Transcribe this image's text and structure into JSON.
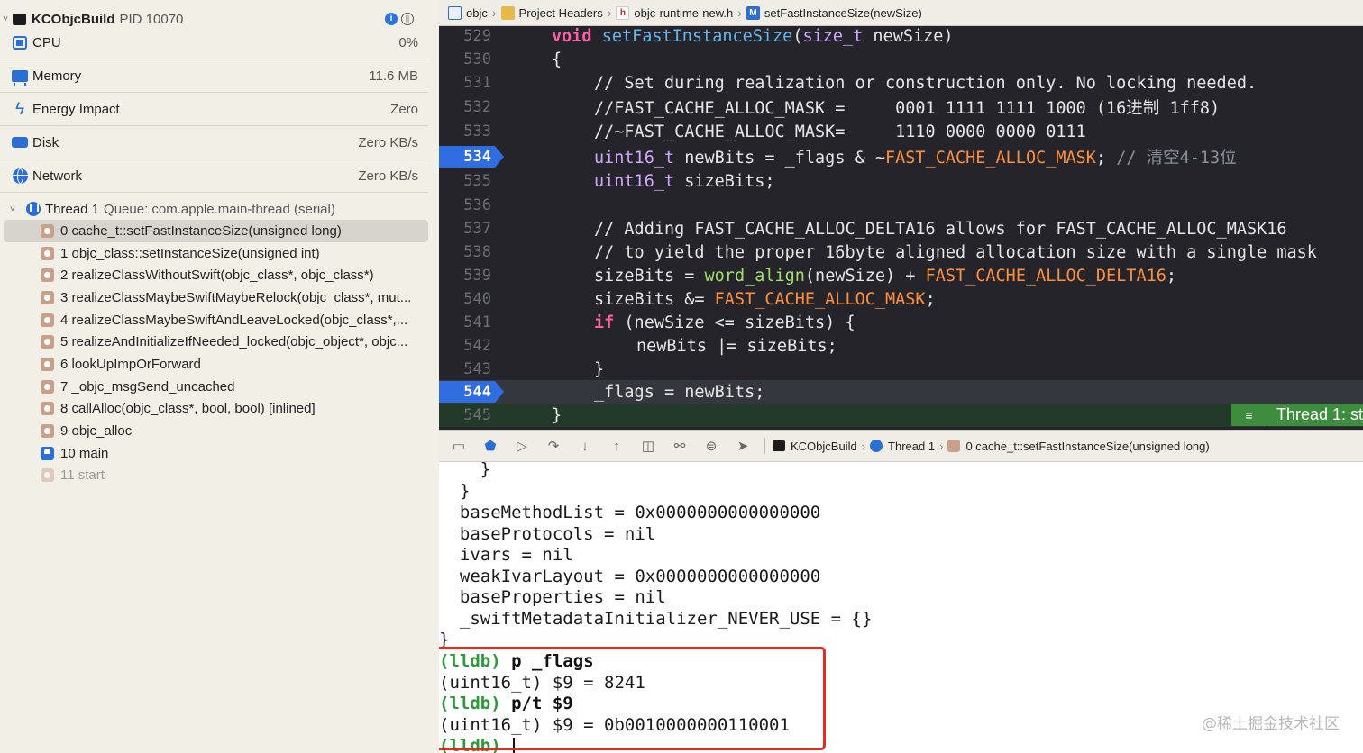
{
  "process": {
    "name": "KCObjcBuild",
    "pid": "PID 10070"
  },
  "gauges": [
    {
      "label": "CPU",
      "value": "0%",
      "icon": "cpu-icon"
    },
    {
      "label": "Memory",
      "value": "11.6 MB",
      "icon": "memory-icon"
    },
    {
      "label": "Energy Impact",
      "value": "Zero",
      "icon": "energy-icon"
    },
    {
      "label": "Disk",
      "value": "Zero KB/s",
      "icon": "disk-icon"
    },
    {
      "label": "Network",
      "value": "Zero KB/s",
      "icon": "network-icon"
    }
  ],
  "thread": {
    "label": "Thread 1",
    "queue": "Queue: com.apple.main-thread (serial)"
  },
  "frames": [
    "0 cache_t::setFastInstanceSize(unsigned long)",
    "1 objc_class::setInstanceSize(unsigned int)",
    "2 realizeClassWithoutSwift(objc_class*, objc_class*)",
    "3 realizeClassMaybeSwiftMaybeRelock(objc_class*, mut...",
    "4 realizeClassMaybeSwiftAndLeaveLocked(objc_class*,...",
    "5 realizeAndInitializeIfNeeded_locked(objc_object*, objc...",
    "6 lookUpImpOrForward",
    "7 _objc_msgSend_uncached",
    "8 callAlloc(objc_class*, bool, bool) [inlined]",
    "9 objc_alloc",
    "10 main",
    "11 start"
  ],
  "jumpbar": [
    "objc",
    "Project Headers",
    "objc-runtime-new.h",
    "setFastInstanceSize(newSize)"
  ],
  "editor": {
    "line_numbers": [
      "529",
      "530",
      "531",
      "532",
      "533",
      "534",
      "535",
      "536",
      "537",
      "538",
      "539",
      "540",
      "541",
      "542",
      "543",
      "544",
      "545"
    ],
    "l529": {
      "kw": "void",
      "fn": "setFastInstanceSize",
      "rest": "(size_t newSize)",
      "ty": "size_t",
      "p1": "(",
      "p2": " newSize)"
    },
    "l530": "{",
    "l531": "// Set during realization or construction only. No locking needed.",
    "l532": "//FAST_CACHE_ALLOC_MASK =     0001 1111 1111 1000 (16进制 1ff8)",
    "l533": "//~FAST_CACHE_ALLOC_MASK=     1110 0000 0000 0111",
    "l534": {
      "ty": "uint16_t",
      "a": " newBits = _flags & ~",
      "mc": "FAST_CACHE_ALLOC_MASK",
      "b": "; ",
      "cm": "// 清空4-13位"
    },
    "l535": {
      "ty": "uint16_t",
      "a": " sizeBits;"
    },
    "l536": "",
    "l537": "// Adding FAST_CACHE_ALLOC_DELTA16 allows for FAST_CACHE_ALLOC_MASK16",
    "l538": "// to yield the proper 16byte aligned allocation size with a single mask",
    "l539": {
      "a": "sizeBits = ",
      "fn": "word_align",
      "b": "(newSize) + ",
      "mc": "FAST_CACHE_ALLOC_DELTA16",
      "c": ";"
    },
    "l540": {
      "a": "sizeBits &= ",
      "mc": "FAST_CACHE_ALLOC_MASK",
      "c": ";"
    },
    "l541": {
      "kw": "if",
      "a": " (newSize <= sizeBits) {"
    },
    "l542": "newBits |= sizeBits;",
    "l543": "}",
    "l544": "_flags = newBits;",
    "l545": "}",
    "thread_badge": "Thread 1: st"
  },
  "debugbar": {
    "app": "KCObjcBuild",
    "thread": "Thread 1",
    "frame": "0 cache_t::setFastInstanceSize(unsigned long)"
  },
  "console": {
    "lines": [
      "    }",
      "  }",
      "  baseMethodList = 0x0000000000000000",
      "  baseProtocols = nil",
      "  ivars = nil",
      "  weakIvarLayout = 0x0000000000000000",
      "  baseProperties = nil",
      "  _swiftMetadataInitializer_NEVER_USE = {}",
      "}"
    ],
    "prompt": "(lldb)",
    "cmd1": "p _flags",
    "out1": "(uint16_t) $9 = 8241",
    "cmd2": "p/t $9",
    "out2": "(uint16_t) $9 = 0b0010000000110001",
    "watermark": "@稀土掘金技术社区"
  }
}
